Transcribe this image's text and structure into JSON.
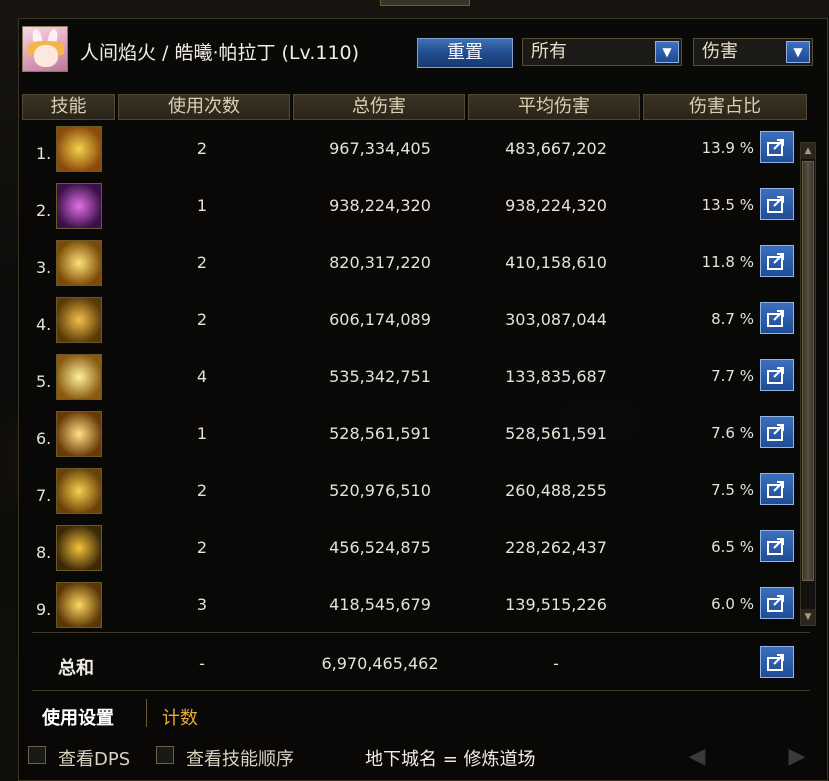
{
  "header": {
    "character": "人间焰火 / 皓曦·帕拉丁 (Lv.110)",
    "reset_label": "重置",
    "filter_scope": "所有",
    "filter_metric": "伤害"
  },
  "columns": [
    "技能",
    "使用次数",
    "总伤害",
    "平均伤害",
    "伤害占比"
  ],
  "rows": [
    {
      "rank": "1.",
      "uses": "2",
      "total": "967,334,405",
      "avg": "483,667,202",
      "pct": "13.9 %",
      "icon": "swirl-skill-icon",
      "colors": [
        "#f7d24a",
        "#8a4a0c"
      ]
    },
    {
      "rank": "2.",
      "uses": "1",
      "total": "938,224,320",
      "avg": "938,224,320",
      "pct": "13.5 %",
      "icon": "violet-burst-skill-icon",
      "colors": [
        "#e070e8",
        "#3a1046"
      ]
    },
    {
      "rank": "3.",
      "uses": "2",
      "total": "820,317,220",
      "avg": "410,158,610",
      "pct": "11.8 %",
      "icon": "light-pillar-skill-icon",
      "colors": [
        "#ffe27a",
        "#7a4a06"
      ]
    },
    {
      "rank": "4.",
      "uses": "2",
      "total": "606,174,089",
      "avg": "303,087,044",
      "pct": "8.7 %",
      "icon": "golden-wave-skill-icon",
      "colors": [
        "#f3c04a",
        "#5a3a08"
      ]
    },
    {
      "rank": "5.",
      "uses": "4",
      "total": "535,342,751",
      "avg": "133,835,687",
      "pct": "7.7 %",
      "icon": "starburst-skill-icon",
      "colors": [
        "#fff2a0",
        "#8a5a10"
      ]
    },
    {
      "rank": "6.",
      "uses": "1",
      "total": "528,561,591",
      "avg": "528,561,591",
      "pct": "7.6 %",
      "icon": "radiant-cross-skill-icon",
      "colors": [
        "#ffe08a",
        "#6a3a06"
      ]
    },
    {
      "rank": "7.",
      "uses": "2",
      "total": "520,976,510",
      "avg": "260,488,255",
      "pct": "7.5 %",
      "icon": "sword-rain-skill-icon",
      "colors": [
        "#f8d050",
        "#6a4208"
      ]
    },
    {
      "rank": "8.",
      "uses": "2",
      "total": "456,524,875",
      "avg": "228,262,437",
      "pct": "6.5 %",
      "icon": "halo-skill-icon",
      "colors": [
        "#f6c23e",
        "#3a2806"
      ]
    },
    {
      "rank": "9.",
      "uses": "3",
      "total": "418,545,679",
      "avg": "139,515,226",
      "pct": "6.0 %",
      "icon": "golden-gate-skill-icon",
      "colors": [
        "#ffd860",
        "#5a3606"
      ]
    }
  ],
  "summary": {
    "label": "总和",
    "uses": "-",
    "total": "6,970,465,462",
    "avg": "-"
  },
  "tabs": {
    "settings": "使用设置",
    "count": "计数"
  },
  "footer": {
    "view_dps": "查看DPS",
    "view_order": "查看技能顺序",
    "dungeon": "地下城名 = 修炼道场"
  }
}
